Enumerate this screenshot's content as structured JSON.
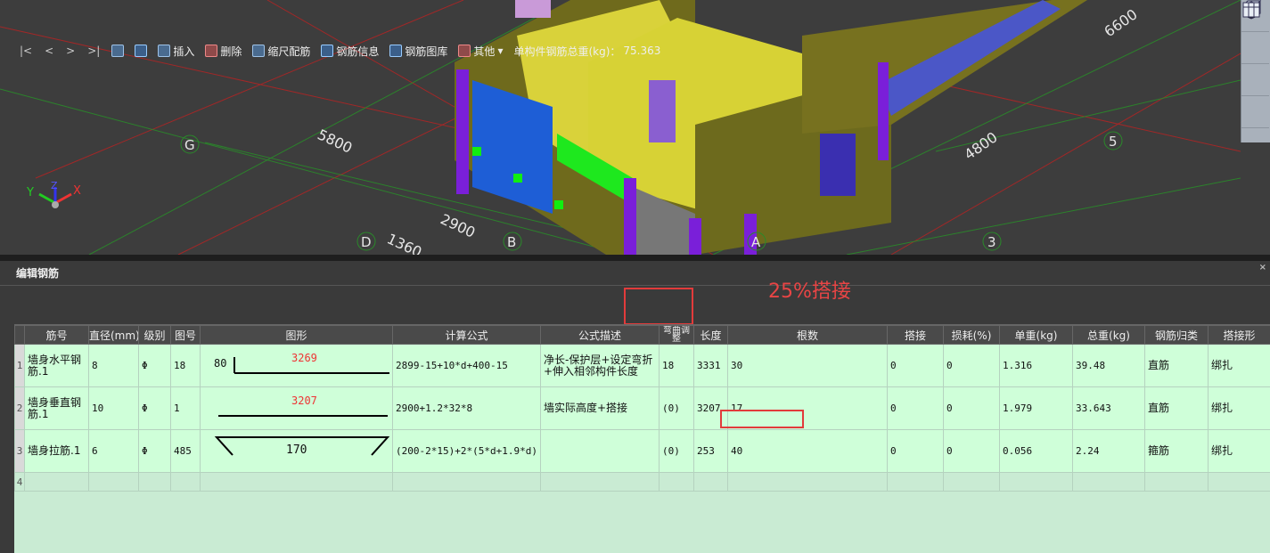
{
  "viewport": {
    "axis_labels": [
      "G",
      "D",
      "B",
      "A",
      "3",
      "5"
    ],
    "dimensions": [
      "5800",
      "2900",
      "1360",
      "4800",
      "6600"
    ],
    "triad": {
      "x": "X",
      "y": "Y",
      "z": "Z"
    }
  },
  "view_tools": [
    "cube-front-icon",
    "cube-iso-icon",
    "rotate-icon",
    "grid-view-icon"
  ],
  "panel": {
    "title": "编辑钢筋",
    "close": "×"
  },
  "toolbar": {
    "nav_first": "|<",
    "nav_prev": "<",
    "nav_next": ">",
    "nav_last": ">|",
    "insert": "插入",
    "delete": "删除",
    "scale_bar": "缩尺配筋",
    "rebar_info": "钢筋信息",
    "rebar_library": "钢筋图库",
    "other": "其他",
    "total_label": "单构件钢筋总重(kg)：",
    "total_value": "75.363"
  },
  "annotation": {
    "lap_text": "25%搭接"
  },
  "table": {
    "headers": [
      "筋号",
      "直径(mm)",
      "级别",
      "图号",
      "图形",
      "计算公式",
      "公式描述",
      "弯曲调整",
      "长度",
      "根数",
      "搭接",
      "损耗(%)",
      "单重(kg)",
      "总重(kg)",
      "钢筋归类",
      "搭接形"
    ],
    "rows": [
      {
        "no": "1",
        "name": "墙身水平钢筋.1",
        "dia": "8",
        "grade": "Φ",
        "fig": "18",
        "shape_left": "80",
        "shape_val": "3269",
        "formula": "2899-15+10*d+400-15",
        "desc": "净长-保护层+设定弯折+伸入相邻构件长度",
        "bend": "18",
        "length": "3331",
        "count": "30",
        "lap": "0",
        "loss": "0",
        "unit": "1.316",
        "total": "39.48",
        "cat": "直筋",
        "laptype": "绑扎"
      },
      {
        "no": "2",
        "name": "墙身垂直钢筋.1",
        "dia": "10",
        "grade": "Φ",
        "fig": "1",
        "shape_left": "",
        "shape_val": "3207",
        "formula": "2900+1.2*32*8",
        "desc": "墙实际高度+搭接",
        "bend": "(0)",
        "length": "3207",
        "count": "17",
        "lap": "0",
        "loss": "0",
        "unit": "1.979",
        "total": "33.643",
        "cat": "直筋",
        "laptype": "绑扎"
      },
      {
        "no": "3",
        "name": "墙身拉筋.1",
        "dia": "6",
        "grade": "Φ",
        "fig": "485",
        "shape_left": "",
        "shape_val": "170",
        "formula": "(200-2*15)+2*(5*d+1.9*d)",
        "desc": "",
        "bend": "(0)",
        "length": "253",
        "count": "40",
        "lap": "0",
        "loss": "0",
        "unit": "0.056",
        "total": "2.24",
        "cat": "箍筋",
        "laptype": "绑扎"
      }
    ],
    "empty_row_no": "4"
  }
}
